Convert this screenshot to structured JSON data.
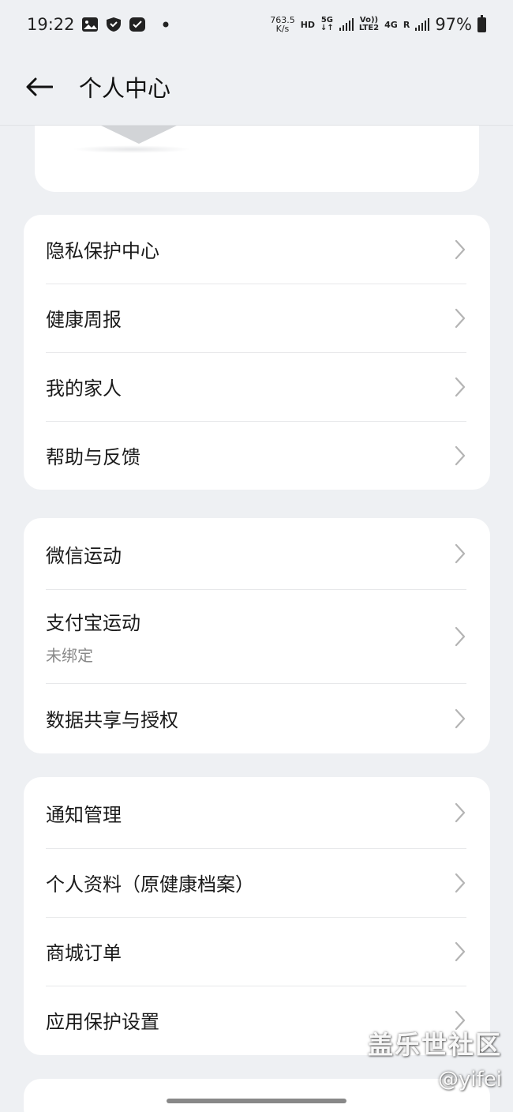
{
  "status_bar": {
    "time": "19:22",
    "speed_value": "763.5",
    "speed_unit": "K/s",
    "hd": "HD",
    "net_5g": "5G",
    "volte_top": "Vo))",
    "volte_bottom": "LTE2",
    "net_4g": "4G",
    "roaming": "R",
    "battery": "97%"
  },
  "header": {
    "title": "个人中心"
  },
  "groups": [
    {
      "items": [
        {
          "label": "隐私保护中心"
        },
        {
          "label": "健康周报"
        },
        {
          "label": "我的家人"
        },
        {
          "label": "帮助与反馈"
        }
      ]
    },
    {
      "items": [
        {
          "label": "微信运动"
        },
        {
          "label": "支付宝运动",
          "sub": "未绑定"
        },
        {
          "label": "数据共享与授权"
        }
      ]
    },
    {
      "items": [
        {
          "label": "通知管理"
        },
        {
          "label": "个人资料（原健康档案）"
        },
        {
          "label": "商城订单"
        },
        {
          "label": "应用保护设置"
        }
      ]
    }
  ],
  "watermark": {
    "brand": "盖乐世社区",
    "user": "@yifei"
  },
  "icons": [
    "image-icon",
    "shield-icon",
    "check-badge-icon",
    "dot-icon",
    "signal-icon",
    "battery-icon",
    "back-arrow-icon",
    "chevron-right-icon"
  ]
}
